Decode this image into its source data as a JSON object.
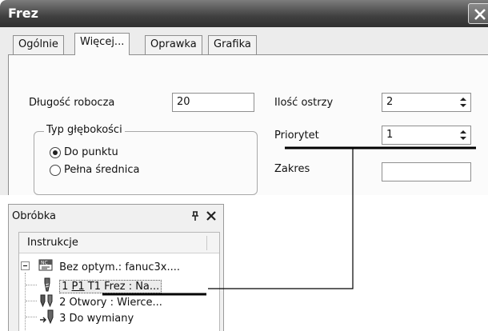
{
  "window": {
    "title": "Frez",
    "close_glyph": "✕"
  },
  "tabs": [
    {
      "label": "Ogólnie",
      "active": false
    },
    {
      "label": "Więcej...",
      "active": true
    },
    {
      "label": "Oprawka",
      "active": false
    },
    {
      "label": "Grafika",
      "active": false
    }
  ],
  "form": {
    "dlugosc_label": "Długość robocza",
    "dlugosc_value": "20",
    "ilosc_label": "Ilość ostrzy",
    "ilosc_value": "2",
    "priorytet_label": "Priorytet",
    "priorytet_value": "1",
    "zakres_label": "Zakres",
    "zakres_value": "",
    "typ_group_label": "Typ głębokości",
    "radio_do_punktu": "Do punktu",
    "radio_pelna": "Pełna średnica",
    "radio_selected": "Do punktu"
  },
  "panel": {
    "title": "Obróbka",
    "column_header": "Instrukcje",
    "root": {
      "label": "Bez optym.: fanuc3x....",
      "icon": "nc-program-icon"
    },
    "items": [
      {
        "prefix": "1 ",
        "underlined": "P1",
        "suffix": " T1 Frez : Na...",
        "icon": "mill-tool-icon",
        "selected": true
      },
      {
        "prefix": "2 Otwory : Wierce...",
        "underlined": "",
        "suffix": "",
        "icon": "drill-tool-icon",
        "selected": false
      },
      {
        "prefix": "3 Do wymiany",
        "underlined": "",
        "suffix": "",
        "icon": "tool-change-icon",
        "selected": false
      }
    ]
  },
  "colors": {
    "titlebar_dark": "#303030",
    "dialog_bg": "#ececec",
    "panel_bg": "#f0f0f0",
    "callout_line": "#000000"
  }
}
